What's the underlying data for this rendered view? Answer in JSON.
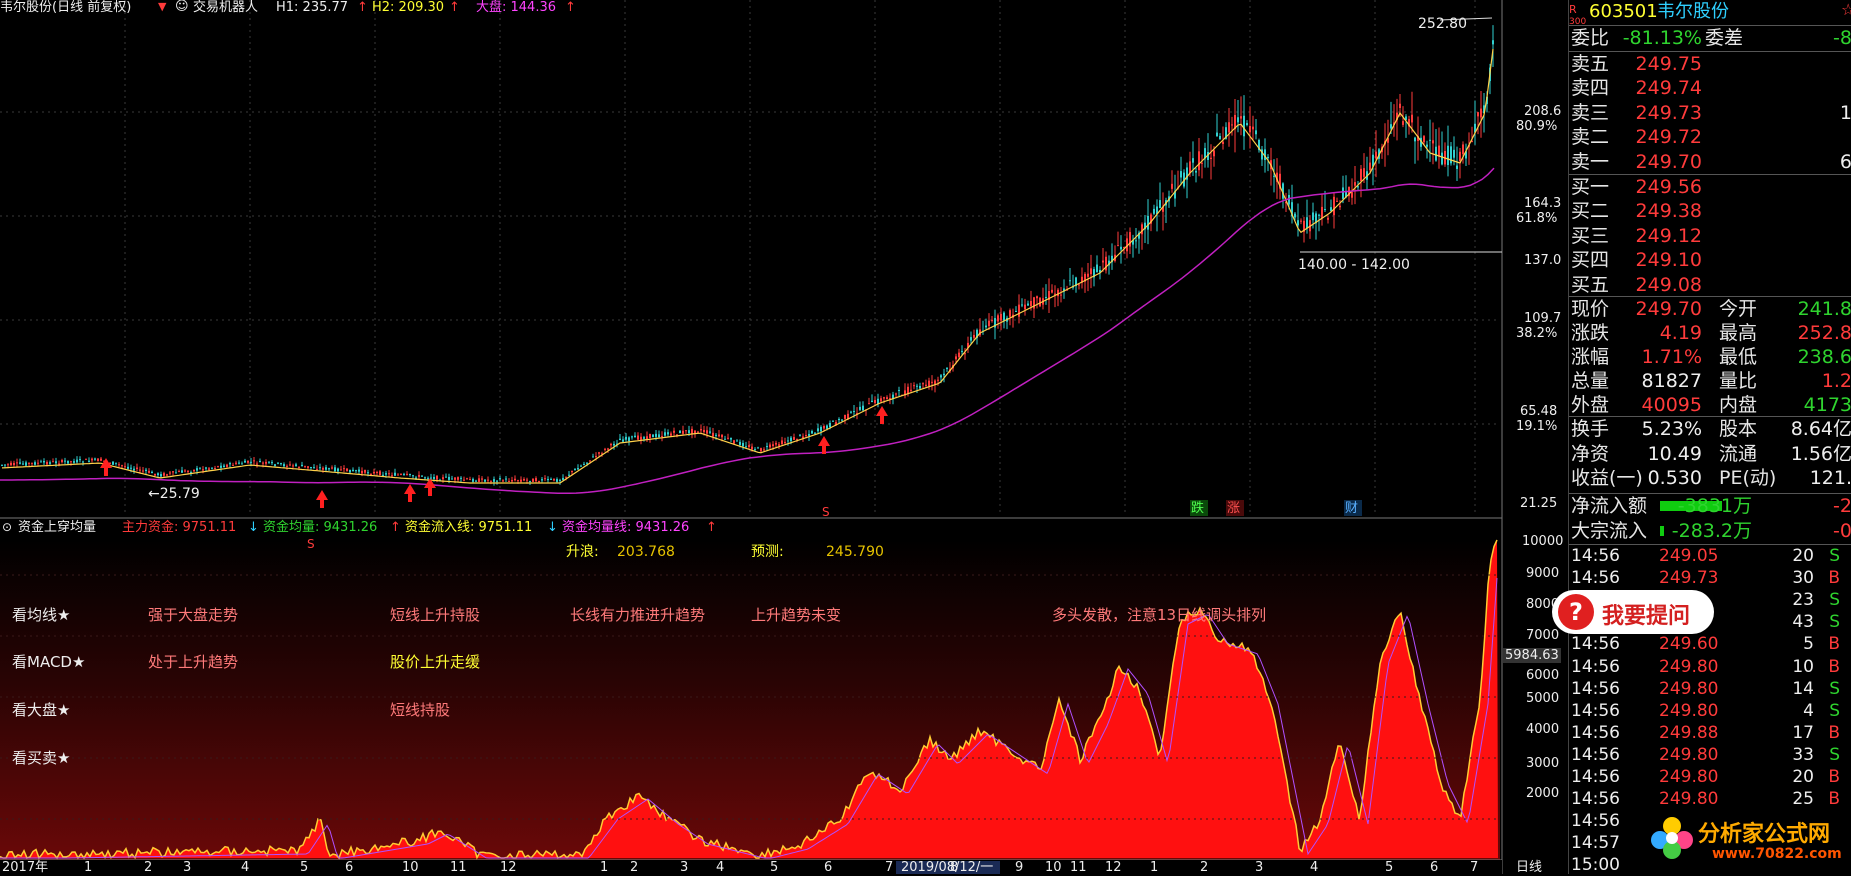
{
  "main_header": {
    "stock": "韦尔股份(日线 前复权)",
    "robot": "交易机器人",
    "h1": "H1: 235.77",
    "h2": "H2: 209.30",
    "index": "大盘: 144.36"
  },
  "price_axis": {
    "labels": [
      "208.6",
      "164.3",
      "137.0",
      "109.7",
      "65.48",
      "21.25"
    ],
    "percents": [
      "80.9%",
      "61.8%",
      "38.2%",
      "19.1%"
    ]
  },
  "annotations": {
    "high_label": "252.80",
    "low_label": "←25.79",
    "range_label": "140.00 - 142.00",
    "event_die": "跌",
    "event_zhang": "涨",
    "event_cai": "财"
  },
  "indicator_header": {
    "name": "资金上穿均量",
    "main_fund": "主力资金: 9751.11",
    "fund_avg": "资金均量: 9431.26",
    "inflow": "资金流入线: 9751.11",
    "inflow_avg": "资金均量线: 9431.26"
  },
  "forecast": {
    "rise_label": "升浪:",
    "rise_value": "203.768",
    "predict_label": "预测:",
    "predict_value": "245.790"
  },
  "analysis": {
    "row1_label": "看均线★",
    "row2_label": "看MACD★",
    "row3_label": "看大盘★",
    "row4_label": "看买卖★",
    "t1": "强于大盘走势",
    "t2": "短线上升持股",
    "t3": "长线有力推进升趋势",
    "t4": "上升趋势未变",
    "t5": "多头发散，注意13日线调头排列",
    "t6": "处于上升趋势",
    "t7": "股价上升走缓",
    "t8": "短线持股"
  },
  "volume_axis": {
    "labels": [
      "10000",
      "9000",
      "8000",
      "7000",
      "6000",
      "5000",
      "4000",
      "3000",
      "2000"
    ],
    "current": "5984.63"
  },
  "time_axis": {
    "labels": [
      "2017年",
      "1",
      "2",
      "3",
      "4",
      "5",
      "6",
      "10",
      "11",
      "12",
      "1",
      "2",
      "3",
      "4",
      "5",
      "6",
      "7",
      "8",
      "9",
      "10",
      "11",
      "12",
      "1",
      "2",
      "3",
      "4",
      "5",
      "6",
      "7"
    ],
    "cursor": "2019/08/12/一",
    "period": "日线"
  },
  "quote": {
    "code": "603501",
    "name": "韦尔股份",
    "badge_top": "R",
    "badge_bottom": "300",
    "weibi_label": "委比",
    "weibi_value": "-81.13%",
    "weicha_label": "委差",
    "weicha_value": "-8",
    "asks": [
      {
        "label": "卖五",
        "price": "249.75",
        "vol": ""
      },
      {
        "label": "卖四",
        "price": "249.74",
        "vol": ""
      },
      {
        "label": "卖三",
        "price": "249.73",
        "vol": "1"
      },
      {
        "label": "卖二",
        "price": "249.72",
        "vol": ""
      },
      {
        "label": "卖一",
        "price": "249.70",
        "vol": "6"
      }
    ],
    "bids": [
      {
        "label": "买一",
        "price": "249.56"
      },
      {
        "label": "买二",
        "price": "249.38"
      },
      {
        "label": "买三",
        "price": "249.12"
      },
      {
        "label": "买四",
        "price": "249.10"
      },
      {
        "label": "买五",
        "price": "249.08"
      }
    ],
    "stats": [
      {
        "l1": "现价",
        "v1": "249.70",
        "l2": "今开",
        "v2": "241.8"
      },
      {
        "l1": "涨跌",
        "v1": "4.19",
        "l2": "最高",
        "v2": "252.8"
      },
      {
        "l1": "涨幅",
        "v1": "1.71%",
        "l2": "最低",
        "v2": "238.6"
      },
      {
        "l1": "总量",
        "v1": "81827",
        "l2": "量比",
        "v2": "1.2"
      },
      {
        "l1": "外盘",
        "v1": "40095",
        "l2": "内盘",
        "v2": "4173"
      }
    ],
    "stats2": [
      {
        "l1": "换手",
        "v1": "5.23%",
        "l2": "股本",
        "v2": "8.64亿"
      },
      {
        "l1": "净资",
        "v1": "10.49",
        "l2": "流通",
        "v2": "1.56亿"
      },
      {
        "l1": "收益(一)",
        "v1": "0.530",
        "l2": "PE(动)",
        "v2": "121."
      }
    ],
    "flow": [
      {
        "label": "净流入额",
        "value": "-3831万",
        "extra": "-2"
      },
      {
        "label": "大宗流入",
        "value": "-283.2万",
        "extra": "-0"
      }
    ],
    "ticks": [
      {
        "time": "14:56",
        "price": "249.05",
        "vol": "20",
        "side": "S"
      },
      {
        "time": "14:56",
        "price": "249.73",
        "vol": "30",
        "side": "B"
      },
      {
        "time": "14:56",
        "price": "",
        "vol": "23",
        "side": "S"
      },
      {
        "time": "14:56",
        "price": "",
        "vol": "43",
        "side": "S"
      },
      {
        "time": "14:56",
        "price": "249.60",
        "vol": "5",
        "side": "B"
      },
      {
        "time": "14:56",
        "price": "249.80",
        "vol": "10",
        "side": "B"
      },
      {
        "time": "14:56",
        "price": "249.80",
        "vol": "14",
        "side": "S"
      },
      {
        "time": "14:56",
        "price": "249.80",
        "vol": "4",
        "side": "S"
      },
      {
        "time": "14:56",
        "price": "249.88",
        "vol": "17",
        "side": "B"
      },
      {
        "time": "14:56",
        "price": "249.80",
        "vol": "33",
        "side": "S"
      },
      {
        "time": "14:56",
        "price": "249.80",
        "vol": "20",
        "side": "B"
      },
      {
        "time": "14:56",
        "price": "249.80",
        "vol": "25",
        "side": "B"
      },
      {
        "time": "14:56",
        "price": "",
        "vol": "",
        "side": ""
      },
      {
        "time": "14:57",
        "price": "",
        "vol": "",
        "side": ""
      },
      {
        "time": "15:00",
        "price": "",
        "vol": "",
        "side": ""
      }
    ]
  },
  "ask_button": {
    "text": "我要提问",
    "icon": "?"
  },
  "watermark": {
    "line1": "分析家公式网",
    "line2": "www.70822.com"
  },
  "colors": {
    "up": "#ff3b3b",
    "down": "#2fd42f",
    "ma_long": "#c020c0",
    "fill": "#ff1010"
  }
}
